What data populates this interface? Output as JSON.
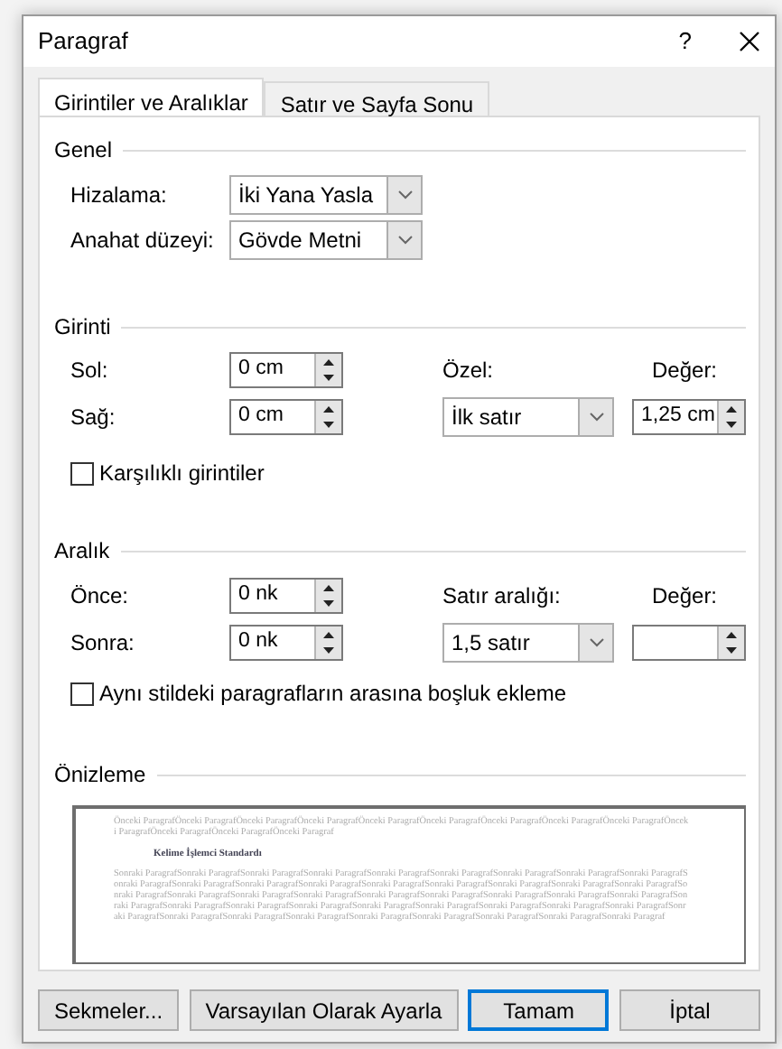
{
  "window": {
    "title": "Paragraf",
    "help": "?"
  },
  "tabs": [
    {
      "label": "Girintiler ve Aralıklar",
      "selected": true
    },
    {
      "label": "Satır ve Sayfa Sonu",
      "selected": false
    }
  ],
  "general": {
    "title": "Genel",
    "alignment": {
      "label": "Hizalama:",
      "value": "İki Yana Yasla"
    },
    "outline_level": {
      "label": "Anahat düzeyi:",
      "value": "Gövde Metni"
    }
  },
  "indentation": {
    "title": "Girinti",
    "left": {
      "label": "Sol:",
      "value": "0 cm"
    },
    "right": {
      "label": "Sağ:",
      "value": "0 cm"
    },
    "special": {
      "label": "Özel:",
      "value": "İlk satır"
    },
    "by": {
      "label": "Değer:",
      "value": "1,25 cm"
    },
    "mirror": {
      "label": "Karşılıklı girintiler",
      "checked": false
    }
  },
  "spacing": {
    "title": "Aralık",
    "before": {
      "label": "Önce:",
      "value": "0 nk"
    },
    "after": {
      "label": "Sonra:",
      "value": "0 nk"
    },
    "line_spacing": {
      "label": "Satır aralığı:",
      "value": "1,5 satır"
    },
    "at": {
      "label": "Değer:"
    },
    "dont_add": {
      "label": "Aynı stildeki paragrafların arasına boşluk ekleme",
      "checked": false
    }
  },
  "preview": {
    "title": "Önizleme",
    "previous_text": "Önceki ParagrafÖnceki ParagrafÖnceki ParagrafÖnceki ParagrafÖnceki ParagrafÖnceki ParagrafÖnceki ParagrafÖnceki ParagrafÖnceki ParagrafÖnceki ParagrafÖnceki ParagrafÖnceki ParagrafÖnceki Paragraf",
    "sample_text": "Kelime İşlemci Standardı",
    "next_text": "Sonraki ParagrafSonraki ParagrafSonraki ParagrafSonraki ParagrafSonraki ParagrafSonraki ParagrafSonraki ParagrafSonraki ParagrafSonraki ParagrafSonraki ParagrafSonraki ParagrafSonraki ParagrafSonraki ParagrafSonraki ParagrafSonraki ParagrafSonraki ParagrafSonraki ParagrafSonraki ParagrafSonraki ParagrafSonraki ParagrafSonraki ParagrafSonraki ParagrafSonraki ParagrafSonraki ParagrafSonraki ParagrafSonraki ParagrafSonraki ParagrafSonraki ParagrafSonraki ParagrafSonraki ParagrafSonraki ParagrafSonraki ParagrafSonraki ParagrafSonraki ParagrafSonraki ParagrafSonraki ParagrafSonraki ParagrafSonraki ParagrafSonraki ParagrafSonraki ParagrafSonraki ParagrafSonraki ParagrafSonraki ParagrafSonraki ParagrafSonraki Paragraf"
  },
  "buttons": [
    {
      "label": "Sekmeler...",
      "default": false
    },
    {
      "label": "Varsayılan Olarak Ayarla",
      "default": false
    },
    {
      "label": "Tamam",
      "default": true
    },
    {
      "label": "İptal",
      "default": false
    }
  ]
}
